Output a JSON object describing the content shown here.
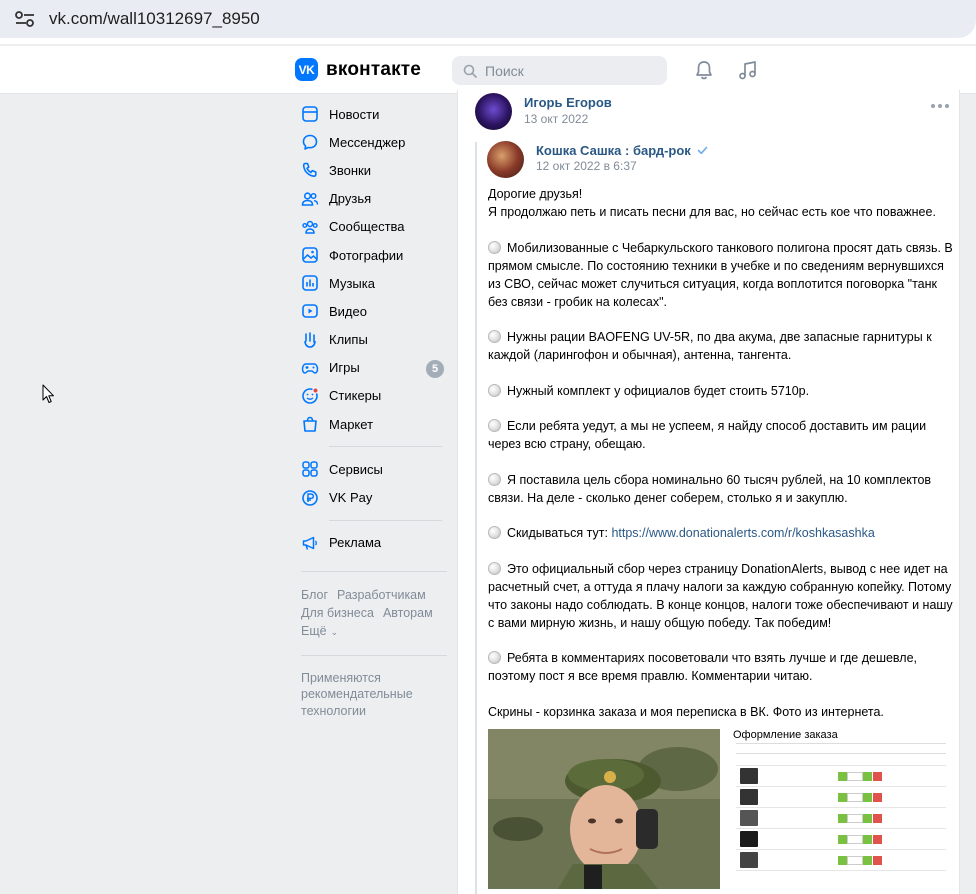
{
  "browser": {
    "url": "vk.com/wall10312697_8950"
  },
  "header": {
    "logo_text": "вконтакте",
    "logo_mark": "VK",
    "search_placeholder": "Поиск"
  },
  "sidebar": {
    "items": [
      {
        "label": "Новости",
        "icon": "news-icon"
      },
      {
        "label": "Мессенджер",
        "icon": "messenger-icon"
      },
      {
        "label": "Звонки",
        "icon": "phone-icon"
      },
      {
        "label": "Друзья",
        "icon": "friends-icon"
      },
      {
        "label": "Сообщества",
        "icon": "communities-icon"
      },
      {
        "label": "Фотографии",
        "icon": "photos-icon"
      },
      {
        "label": "Музыка",
        "icon": "music-icon"
      },
      {
        "label": "Видео",
        "icon": "video-icon"
      },
      {
        "label": "Клипы",
        "icon": "clips-icon"
      },
      {
        "label": "Игры",
        "icon": "games-icon",
        "badge": "5"
      },
      {
        "label": "Стикеры",
        "icon": "stickers-icon"
      },
      {
        "label": "Маркет",
        "icon": "market-icon"
      }
    ],
    "items2": [
      {
        "label": "Сервисы",
        "icon": "services-icon"
      },
      {
        "label": "VK Pay",
        "icon": "vkpay-icon"
      }
    ],
    "items3": [
      {
        "label": "Реклама",
        "icon": "ads-icon"
      }
    ],
    "footer": {
      "blog": "Блог",
      "developers": "Разработчикам",
      "business": "Для бизнеса",
      "authors": "Авторам",
      "more": "Ещё"
    },
    "recs": "Применяются рекомендательные технологии"
  },
  "post": {
    "author": "Игорь Егоров",
    "date": "13 окт 2022",
    "repost": {
      "author": "Кошка Сашка : бард-рок",
      "date": "12 окт 2022 в 6:37"
    },
    "text": {
      "p1a": "Дорогие друзья!",
      "p1b": "Я продолжаю петь и писать песни для вас, но сейчас есть кое что поважнее.",
      "p2": "Мобилизованные с Чебаркульского танкового полигона просят дать связь. В прямом смысле. По состоянию техники в учебке и по сведениям вернувшихся из СВО, сейчас может случиться ситуация, когда воплотится поговорка \"танк без связи - гробик на колесах\".",
      "p3": "Нужны рации BAOFENG UV-5R, по два акума, две запасные гарнитуры к каждой (ларингофон и обычная), антенна, тангента.",
      "p4": "Нужный комплект у официалов будет стоить 5710р.",
      "p5": "Если ребята уедут, а мы не успеем, я найду способ доставить им рации через всю страну, обещаю.",
      "p6": "Я поставила цель сбора номинально 60 тысяч рублей, на 10 комплектов связи. На деле - сколько денег соберем, столько я и закуплю.",
      "p7_prefix": "Скидываться тут: ",
      "p7_link": "https://www.donationalerts.com/r/koshkasashka",
      "p8": "Это официальный сбор через страницу DonationAlerts, вывод с нее идет на расчетный счет, а оттуда я плачу налоги за каждую собранную копейку. Потому что законы надо соблюдать. В конце концов, налоги тоже обеспечивают и нашу с вами мирную жизнь, и нашу общую победу. Так победим!",
      "p9": "Ребята в комментариях посоветовали что взять лучше и где дешевле, поэтому пост я все время правлю. Комментарии читаю.",
      "p10": "Скрины - корзинка заказа и моя переписка в ВК. Фото из интернета."
    },
    "order_title": "Оформление заказа"
  },
  "colors": {
    "accent": "#0077ff",
    "link": "#2a5885",
    "muted": "#818c99",
    "bg": "#edeef0"
  }
}
